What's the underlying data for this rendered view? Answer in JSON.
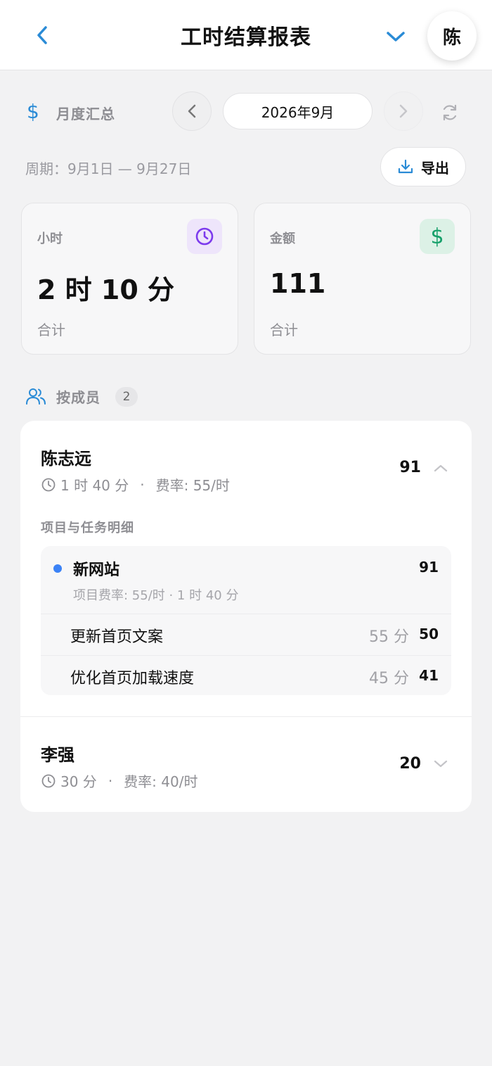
{
  "header": {
    "title": "工时结算报表",
    "avatar_initial": "陈"
  },
  "month_nav": {
    "section_label": "月度汇总",
    "current_month": "2026年9月"
  },
  "period": {
    "text": "周期：9月1日 — 9月27日",
    "export_label": "导出"
  },
  "stats": {
    "hours": {
      "label": "小时",
      "value": "2 时 10 分",
      "sub": "合计"
    },
    "amount": {
      "label": "金额",
      "value": "111",
      "sub": "合计"
    }
  },
  "members": {
    "label": "按成员",
    "count": "2",
    "items": [
      {
        "name": "陈志远",
        "duration": "1 时 40 分",
        "rate": "费率: 55/时",
        "amount": "91",
        "expanded": true,
        "detail_title": "项目与任务明细",
        "project": {
          "name": "新网站",
          "amount": "91",
          "meta": "项目费率: 55/时 · 1 时 40 分",
          "tasks": [
            {
              "name": "更新首页文案",
              "duration": "55 分",
              "amount": "50"
            },
            {
              "name": "优化首页加载速度",
              "duration": "45 分",
              "amount": "41"
            }
          ]
        }
      },
      {
        "name": "李强",
        "duration": "30 分",
        "rate": "费率: 40/时",
        "amount": "20",
        "expanded": false
      }
    ]
  },
  "colors": {
    "accent_blue": "#2a8bd6",
    "project_dot": "#3b82f6",
    "hours_icon": "#7c3aed",
    "amount_icon": "#16a06a"
  }
}
